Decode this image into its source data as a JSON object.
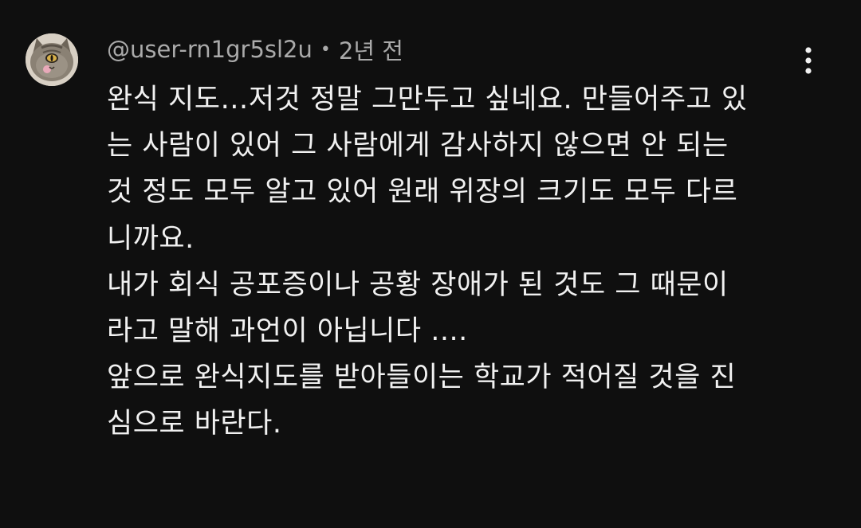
{
  "comment": {
    "author": "@user-rn1gr5sl2u",
    "separator": "•",
    "timestamp": "2년 전",
    "avatar_icon": "cat-avatar-icon",
    "menu_icon": "more-vert-icon",
    "lines": [
      "완식 지도…저것 정말 그만두고 싶네요. 만들어주고 있",
      "는 사람이 있어 그 사람에게 감사하지 않으면 안 되는",
      "것 정도 모두 알고 있어 원래 위장의 크기도 모두 다르",
      "니까요.",
      "내가 회식 공포증이나 공황 장애가 된 것도 그 때문이",
      "라고 말해 과언이 아닙니다 ....",
      "앞으로 완식지도를 받아들이는 학교가 적어질 것을 진",
      "심으로 바란다."
    ]
  },
  "colors": {
    "background": "#0f0f0f",
    "text": "#f1f1f1",
    "meta": "#aaaaaa"
  }
}
